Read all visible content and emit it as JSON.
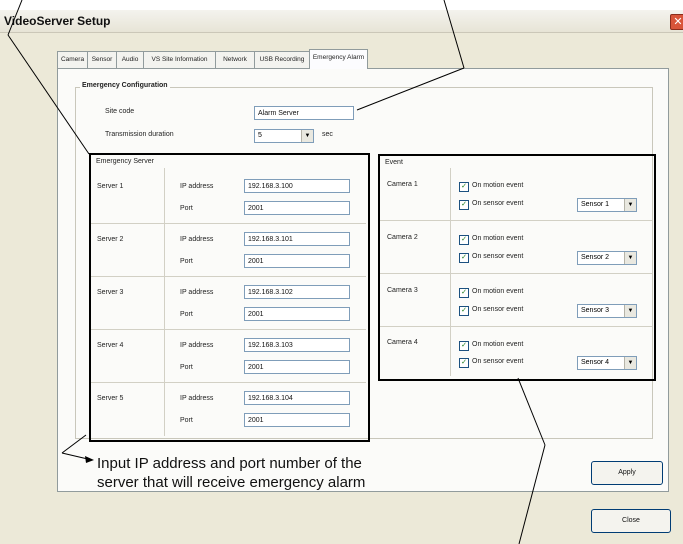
{
  "window": {
    "title": "VideoServer Setup",
    "close_glyph": "✕"
  },
  "tabs": [
    "Camera",
    "Sensor",
    "Audio",
    "VS Site Information",
    "Network",
    "USB Recording",
    "Emergency Alarm"
  ],
  "emergency_config": {
    "title": "Emergency Configuration",
    "site_code_label": "Site code",
    "site_code_value": "Alarm Server",
    "duration_label": "Transmission duration",
    "duration_value": "5",
    "duration_unit": "sec"
  },
  "emergency_server": {
    "title": "Emergency Server",
    "ip_label": "IP address",
    "port_label": "Port",
    "servers": [
      {
        "name": "Server 1",
        "ip": "192.168.3.100",
        "port": "2001"
      },
      {
        "name": "Server 2",
        "ip": "192.168.3.101",
        "port": "2001"
      },
      {
        "name": "Server 3",
        "ip": "192.168.3.102",
        "port": "2001"
      },
      {
        "name": "Server 4",
        "ip": "192.168.3.103",
        "port": "2001"
      },
      {
        "name": "Server 5",
        "ip": "192.168.3.104",
        "port": "2001"
      }
    ]
  },
  "event": {
    "title": "Event",
    "motion_label": "On motion event",
    "sensor_label": "On sensor event",
    "cameras": [
      {
        "name": "Camera 1",
        "motion_checked": true,
        "sensor_checked": true,
        "sensor_select": "Sensor 1"
      },
      {
        "name": "Camera 2",
        "motion_checked": true,
        "sensor_checked": true,
        "sensor_select": "Sensor 2"
      },
      {
        "name": "Camera 3",
        "motion_checked": true,
        "sensor_checked": true,
        "sensor_select": "Sensor 3"
      },
      {
        "name": "Camera 4",
        "motion_checked": true,
        "sensor_checked": true,
        "sensor_select": "Sensor 4"
      }
    ]
  },
  "buttons": {
    "apply": "Apply",
    "close": "Close"
  },
  "annotation": {
    "line1": "Input IP address and port number of the",
    "line2": "server that will receive emergency alarm"
  },
  "icons": {
    "dropdown": "chevron-down-icon",
    "check": "checkmark-icon",
    "close": "close-icon"
  }
}
